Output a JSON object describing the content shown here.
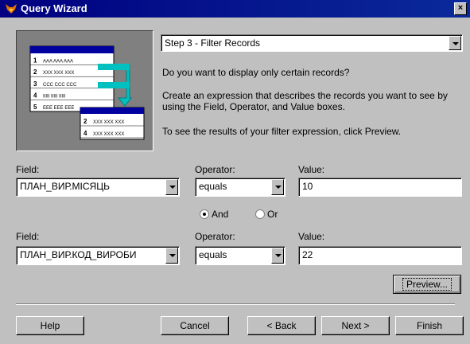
{
  "window": {
    "title": "Query Wizard",
    "close_glyph": "×"
  },
  "step_select": {
    "value": "Step 3 - Filter Records"
  },
  "instructions": {
    "question": "Do you want to display only certain records?",
    "create": "Create an expression that describes the records you want to see by using the Field, Operator, and Value boxes.",
    "preview_hint": "To see the results of your filter expression, click Preview."
  },
  "illustration": {
    "rows": [
      {
        "num": "1",
        "text": "AAA AAA AAA"
      },
      {
        "num": "2",
        "text": "XXX XXX XXX"
      },
      {
        "num": "3",
        "text": "CCC CCC CCC"
      },
      {
        "num": "4",
        "text": "IIIII IIIII IIIII"
      },
      {
        "num": "5",
        "text": "EEE EEE EEE"
      }
    ],
    "result_rows": [
      {
        "num": "2",
        "text": "XXX XXX XXX"
      },
      {
        "num": "4",
        "text": "XXX XXX XXX"
      }
    ]
  },
  "condition1": {
    "field_label": "Field:",
    "field_value": "ПЛАН_ВИР.МІСЯЦЬ",
    "operator_label": "Operator:",
    "operator_value": "equals",
    "value_label": "Value:",
    "value": "10"
  },
  "logic": {
    "and_label": "And",
    "or_label": "Or",
    "selected": "And"
  },
  "condition2": {
    "field_label": "Field:",
    "field_value": "ПЛАН_ВИР.КОД_ВИРОБИ",
    "operator_label": "Operator:",
    "operator_value": "equals",
    "value_label": "Value:",
    "value": "22"
  },
  "buttons": {
    "preview": "Preview...",
    "help": "Help",
    "cancel": "Cancel",
    "back": "< Back",
    "next": "Next >",
    "finish": "Finish"
  },
  "colors": {
    "titlebar": "#000080",
    "dialog_bg": "#c0c0c0",
    "illustration_bg": "#808080",
    "table_header": "#0000a0",
    "arrow": "#00c0c0"
  },
  "icons": {
    "title_icon": "fox-icon",
    "close": "close-icon",
    "dropdown": "chevron-down-icon"
  }
}
